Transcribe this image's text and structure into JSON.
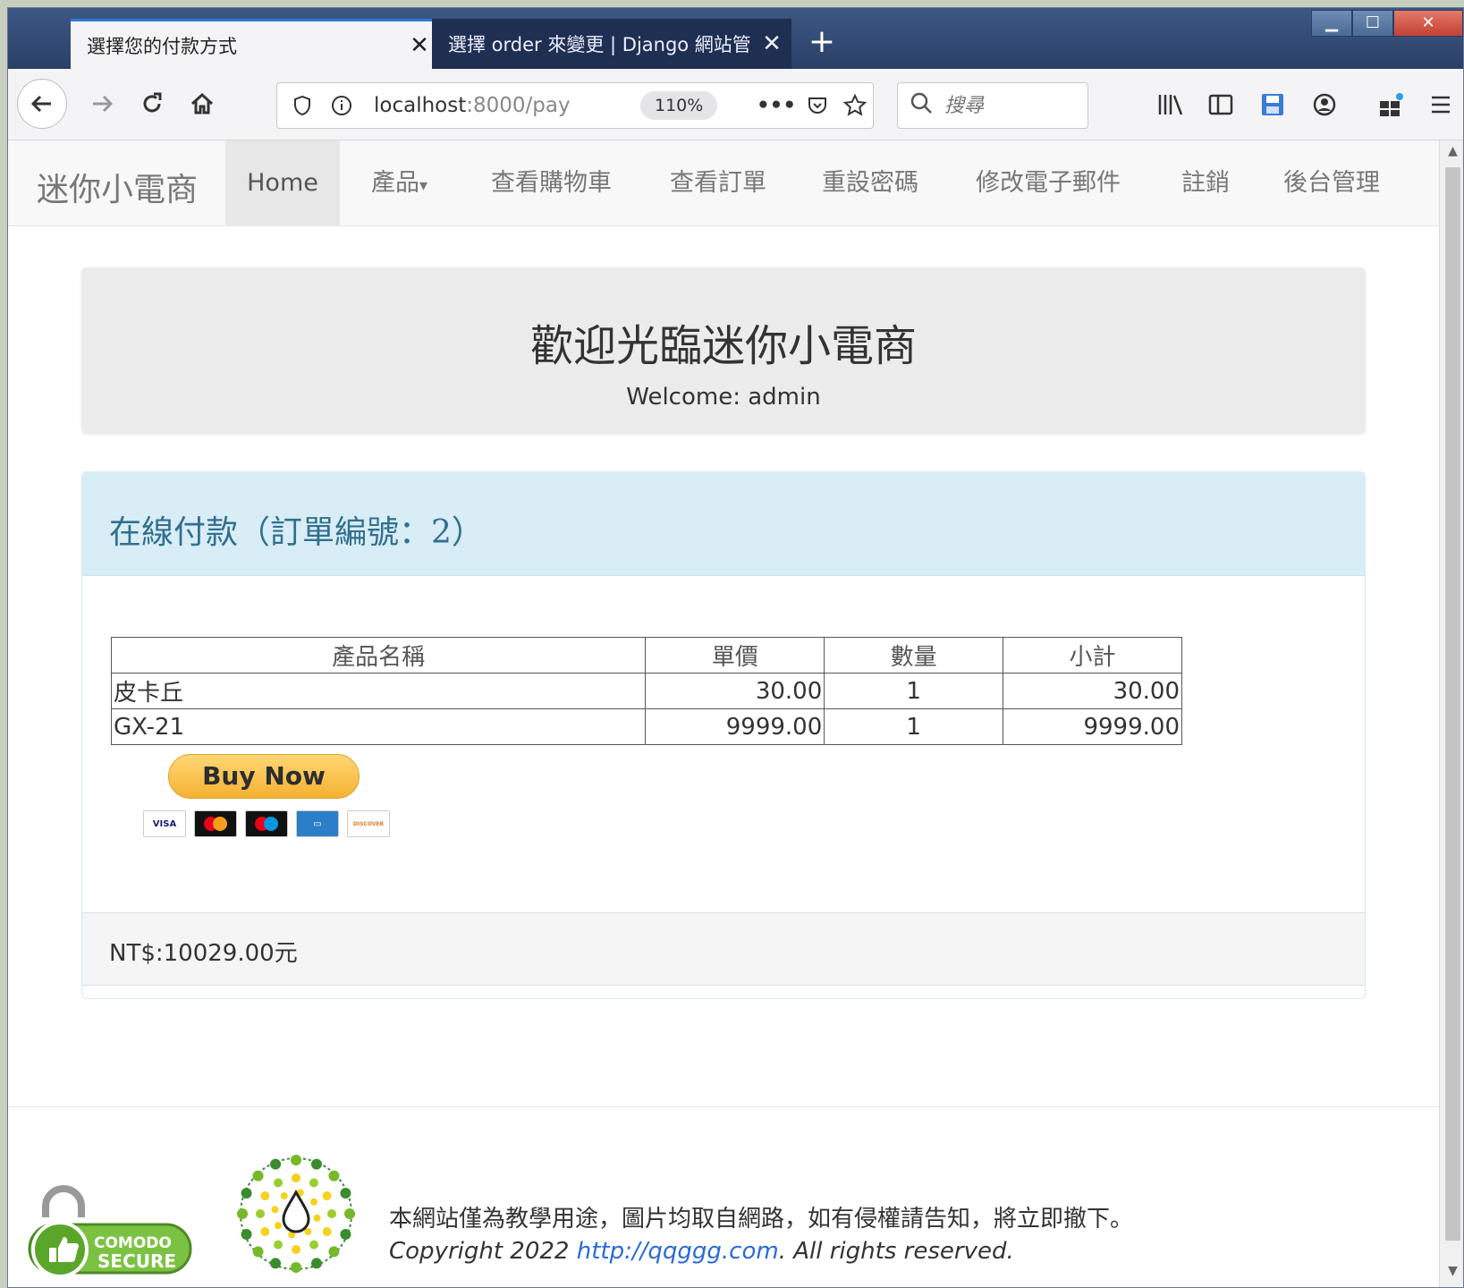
{
  "browser": {
    "tabs": [
      {
        "title": "選擇您的付款方式",
        "close": "✕"
      },
      {
        "title": "選擇 order 來變更 | Django 網站管",
        "close": "✕"
      }
    ],
    "new_tab": "+",
    "url_prefix": "localhost",
    "url_rest": ":8000/pay",
    "zoom": "110%",
    "search_placeholder": "搜尋",
    "page_actions": "•••"
  },
  "site": {
    "brand": "迷你小電商",
    "nav": [
      {
        "label": "Home"
      },
      {
        "label": "產品"
      },
      {
        "label": "查看購物車"
      },
      {
        "label": "查看訂單"
      },
      {
        "label": "重設密碼"
      },
      {
        "label": "修改電子郵件"
      },
      {
        "label": "註銷"
      },
      {
        "label": "後台管理"
      }
    ],
    "dropdown_caret": "▾"
  },
  "jumbotron": {
    "title": "歡迎光臨迷你小電商",
    "welcome": "Welcome: admin"
  },
  "panel": {
    "title": "在線付款（訂單編號：2）",
    "table": {
      "headers": [
        "產品名稱",
        "單價",
        "數量",
        "小計"
      ],
      "rows": [
        {
          "name": "皮卡丘",
          "price": "30.00",
          "qty": "1",
          "subtotal": "30.00"
        },
        {
          "name": "GX-21",
          "price": "9999.00",
          "qty": "1",
          "subtotal": "9999.00"
        }
      ]
    },
    "buy_now": "Buy Now",
    "cards": {
      "visa": "VISA",
      "discover": "DISCOVER"
    },
    "total": "NT$:10029.00元"
  },
  "footer": {
    "comodo_line1": "COMODO",
    "comodo_line2": "SECURE",
    "text1": "本網站僅為教學用途，圖片均取自網路，如有侵權請告知，將立即撤下。",
    "copyright_prefix": "Copyright 2022 ",
    "link": "http://qqggg.com",
    "copyright_suffix": ". All rights reserved."
  },
  "colors": {
    "tab_strip": "#2a4068",
    "panel_heading_bg": "#d9edf7",
    "panel_title": "#31708f",
    "buy_now": "#f5b132",
    "link": "#2a6ad8"
  }
}
